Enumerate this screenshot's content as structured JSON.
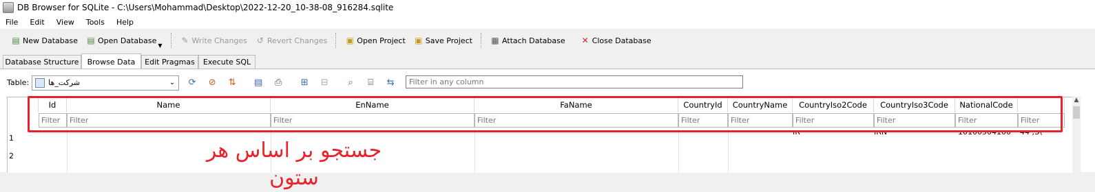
{
  "window": {
    "title": "DB Browser for SQLite - C:\\Users\\Mohammad\\Desktop\\2022-12-20_10-38-08_916284.sqlite"
  },
  "menu": [
    "File",
    "Edit",
    "View",
    "Tools",
    "Help"
  ],
  "toolbar": {
    "new_database": "New Database",
    "open_database": "Open Database",
    "write_changes": "Write Changes",
    "revert_changes": "Revert Changes",
    "open_project": "Open Project",
    "save_project": "Save Project",
    "attach_database": "Attach Database",
    "close_database": "Close Database"
  },
  "tabs": [
    "Database Structure",
    "Browse Data",
    "Edit Pragmas",
    "Execute SQL"
  ],
  "active_tab": "Browse Data",
  "browse": {
    "table_label": "Table:",
    "table_value": "شرکت_ها",
    "filter_all_placeholder": "Filter in any column"
  },
  "grid": {
    "columns": [
      "Id",
      "Name",
      "EnName",
      "FaName",
      "CountryId",
      "CountryName",
      "CountryIso2Code",
      "CountryIso3Code",
      "NationalCode",
      ""
    ],
    "filter_placeholder": "Filter",
    "row_numbers": [
      "1",
      "2"
    ],
    "visible_fragments": [
      "IR",
      "IRN",
      "10100504100",
      "44 ;S\\"
    ]
  },
  "annotation": {
    "text": "جستجو بر اساس هر ستون",
    "color": "#e8212a"
  },
  "icons": [
    "database-new-icon",
    "database-open-icon",
    "write-changes-icon",
    "revert-changes-icon",
    "project-open-icon",
    "project-save-icon",
    "attach-database-icon",
    "close-database-icon"
  ]
}
